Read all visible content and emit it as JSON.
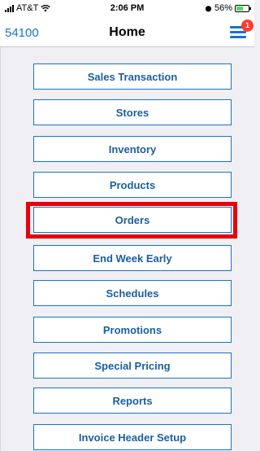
{
  "status_bar": {
    "carrier": "AT&T",
    "time": "2:06 PM",
    "battery_percent": "56%",
    "battery_level": 0.56
  },
  "nav": {
    "store_number": "54100",
    "title": "Home",
    "notification_count": "1"
  },
  "menu": {
    "items": [
      {
        "label": "Sales Transaction"
      },
      {
        "label": "Stores"
      },
      {
        "label": "Inventory"
      },
      {
        "label": "Products"
      },
      {
        "label": "Orders",
        "highlighted": true
      },
      {
        "label": "End Week Early"
      },
      {
        "label": "Schedules"
      },
      {
        "label": "Promotions"
      },
      {
        "label": "Special Pricing"
      },
      {
        "label": "Reports"
      },
      {
        "label": "Invoice Header Setup"
      }
    ]
  },
  "colors": {
    "accent": "#1a73c8",
    "highlight": "#e8000b",
    "badge": "#ff3b30"
  }
}
